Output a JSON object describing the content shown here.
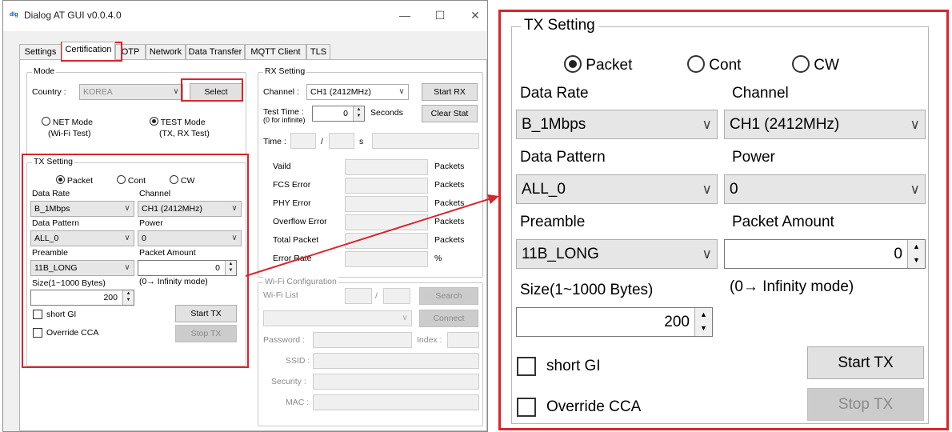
{
  "window": {
    "title": "Dialog AT GUI v0.0.4.0",
    "app_icon": "dialog-logo-icon",
    "minimize": "—",
    "maximize": "☐",
    "close": "✕"
  },
  "tabs": [
    "Settings",
    "Certification",
    "OTP",
    "Network",
    "Data Transfer",
    "MQTT Client",
    "TLS"
  ],
  "mode": {
    "group": "Mode",
    "country_label": "Country :",
    "country_value": "KOREA",
    "select": "Select",
    "net_mode": "NET Mode",
    "net_sub": "(Wi-Fi Test)",
    "test_mode": "TEST Mode",
    "test_sub": "(TX, RX Test)"
  },
  "tx": {
    "group": "TX Setting",
    "packet": "Packet",
    "cont": "Cont",
    "cw": "CW",
    "data_rate_label": "Data Rate",
    "data_rate": "B_1Mbps",
    "channel_label": "Channel",
    "channel": "CH1 (2412MHz)",
    "pattern_label": "Data Pattern",
    "pattern": "ALL_0",
    "power_label": "Power",
    "power": "0",
    "preamble_label": "Preamble",
    "preamble": "11B_LONG",
    "amount_label": "Packet Amount",
    "amount": "0",
    "size_label": "Size(1~1000 Bytes)",
    "size": "200",
    "infinity": "(0→ Infinity mode)",
    "short_gi": "short GI",
    "override_cca": "Override CCA",
    "start_tx": "Start TX",
    "stop_tx": "Stop TX"
  },
  "rx": {
    "group": "RX Setting",
    "channel_label": "Channel :",
    "channel": "CH1 (2412MHz)",
    "start_rx": "Start RX",
    "test_time_label": "Test Time :",
    "test_time_sub": "(0 for infinite)",
    "test_time": "0",
    "seconds": "Seconds",
    "clear_stat": "Clear Stat",
    "time_label": "Time :",
    "slash": "/",
    "s": "s",
    "rows": [
      {
        "label": "Vaild",
        "unit": "Packets"
      },
      {
        "label": "FCS Error",
        "unit": "Packets"
      },
      {
        "label": "PHY Error",
        "unit": "Packets"
      },
      {
        "label": "Overflow Error",
        "unit": "Packets"
      },
      {
        "label": "Total Packet",
        "unit": "Packets"
      },
      {
        "label": "Error Rate",
        "unit": "%"
      }
    ]
  },
  "wifi": {
    "group": "Wi-Fi Configuration",
    "list_label": "Wi-Fi List",
    "slash": "/",
    "search": "Search",
    "connect": "Connect",
    "password": "Password :",
    "index": "Index :",
    "ssid": "SSID :",
    "security": "Security :",
    "mac": "MAC :"
  },
  "colors": {
    "highlight": "#d9252c"
  }
}
